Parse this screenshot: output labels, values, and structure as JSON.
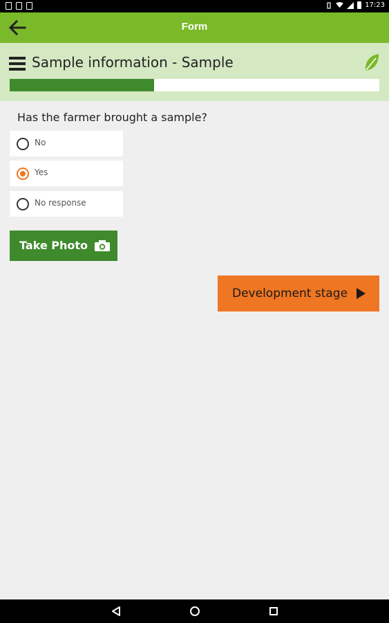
{
  "status_bar": {
    "time": "17:23",
    "icons": [
      "notification-icon",
      "sim-icon",
      "photo-notification-icon",
      "vibrate-icon",
      "wifi-icon",
      "signal-icon",
      "battery-icon"
    ]
  },
  "app_bar": {
    "title": "Form",
    "back_icon": "back-arrow-icon"
  },
  "section": {
    "title": "Sample information - Sample",
    "menu_icon": "hamburger-menu-icon",
    "logo_icon": "leaf-icon",
    "progress": 0.39
  },
  "question": {
    "text": "Has the farmer brought a sample?",
    "options": [
      {
        "label": "No",
        "selected": false
      },
      {
        "label": "Yes",
        "selected": true
      },
      {
        "label": "No response",
        "selected": false
      }
    ]
  },
  "photo_button": {
    "label": "Take Photo",
    "icon": "camera-icon"
  },
  "next_button": {
    "label": "Development stage",
    "icon": "play-arrow-icon"
  },
  "nav_bar": {
    "icons": [
      "back-triangle-icon",
      "home-circle-icon",
      "recents-square-icon"
    ]
  },
  "colors": {
    "app_bar": "#7ab929",
    "section_bg": "#d4e8c2",
    "progress": "#3f8a2c",
    "accent": "#ef7622",
    "photo_button": "#3f8a2c"
  }
}
